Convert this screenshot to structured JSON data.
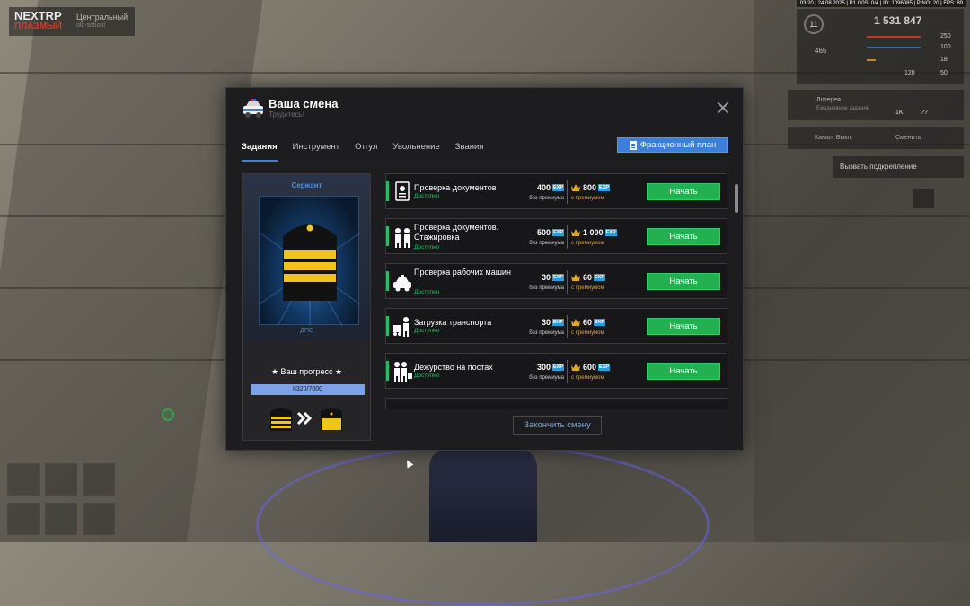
{
  "hud": {
    "top_bar": "03:20 | 24.08.2025 | P1.G0S. 0/4 | ID: 1096085 | PING: 20 | FPS: 89",
    "logo_top": "NEXTRP",
    "logo_bottom": "ПЛАЗМЫЙ",
    "server": "Центральный",
    "server_sub": "old-school",
    "level": "11",
    "money": "1 531 847",
    "stat_1": "465",
    "v1": "250",
    "v2": "100",
    "v3": "18",
    "v4": "120",
    "v5": "50",
    "lottery_title": "Лотерея",
    "lottery_sub": "Ежедневное задание",
    "lottery_k1": "1K",
    "lottery_k2": "??",
    "radio_channel": "Канал: Выкл.",
    "radio_change": "Сменить",
    "backup_label": "Вызвать подкрепление"
  },
  "modal": {
    "title": "Ваша смена",
    "subtitle": "Трудитесь!",
    "tabs": [
      "Задания",
      "Инструмент",
      "Отгул",
      "Увольнение",
      "Звания"
    ],
    "faction_button": "Фракционный план",
    "end_shift_button": "Закончить смену"
  },
  "rank": {
    "name": "Сержант",
    "unit": "ДПС",
    "progress_label": "★ Ваш прогресс ★",
    "progress_text": "8320/7000",
    "progress_fraction": 1.0
  },
  "tasks": [
    {
      "name": "Проверка документов",
      "status": "Доступно",
      "reward": "400",
      "reward_label": "без премиума",
      "prem_reward": "800",
      "prem_label": "с премиумом",
      "button": "Начать",
      "icon": "document-icon"
    },
    {
      "name": "Проверка документов. Стажировка",
      "status": "Доступно",
      "reward": "500",
      "reward_label": "без премиума",
      "prem_reward": "1 000",
      "prem_label": "с премиумом",
      "button": "Начать",
      "icon": "officers-icon"
    },
    {
      "name": "Проверка рабочих машин",
      "status": "Доступно",
      "reward": "30",
      "reward_label": "без премиума",
      "prem_reward": "60",
      "prem_label": "с премиумом",
      "button": "Начать",
      "icon": "police-car-icon"
    },
    {
      "name": "Загрузка транспорта",
      "status": "Доступно",
      "reward": "30",
      "reward_label": "без премиума",
      "prem_reward": "60",
      "prem_label": "с премиумом",
      "button": "Начать",
      "icon": "loader-icon"
    },
    {
      "name": "Дежурство на постах",
      "status": "Доступно",
      "reward": "300",
      "reward_label": "без премиума",
      "prem_reward": "600",
      "prem_label": "с премиумом",
      "button": "Начать",
      "icon": "patrol-icon"
    }
  ],
  "exp_tag": "EXP",
  "colors": {
    "accent": "#3b7fd8",
    "green": "#22b051",
    "premium": "#e0a820",
    "panel": "#1d1d1f"
  }
}
